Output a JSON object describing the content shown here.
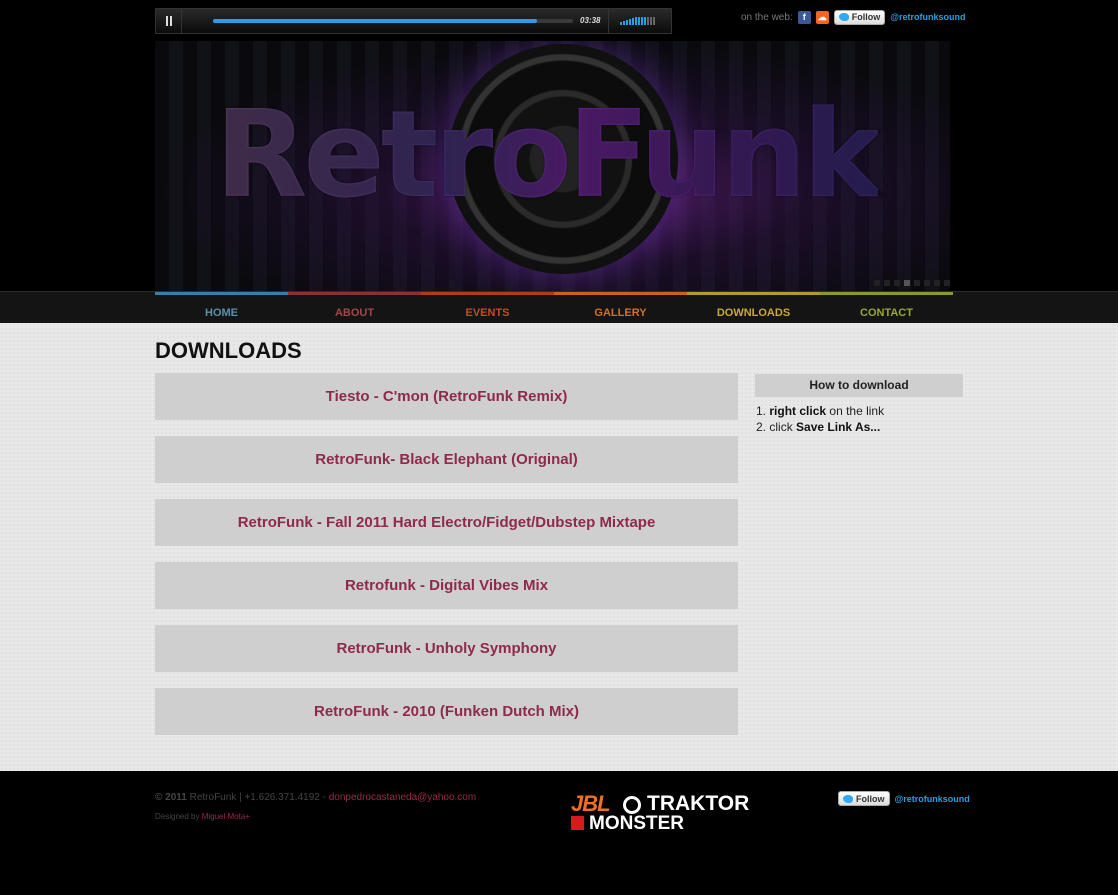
{
  "player": {
    "time": "03:38",
    "progress": 0.9
  },
  "social": {
    "label": "on the web:",
    "facebook_glyph": "f",
    "follow_label": "Follow",
    "handle": "@retrofunksound"
  },
  "banner": {
    "logo_text": "RetroFunk",
    "slides": 8,
    "active_slide": 4
  },
  "nav": {
    "items": [
      {
        "label": "HOME"
      },
      {
        "label": "ABOUT"
      },
      {
        "label": "EVENTS"
      },
      {
        "label": "GALLERY"
      },
      {
        "label": "DOWNLOADS"
      },
      {
        "label": "CONTACT"
      }
    ]
  },
  "main": {
    "title": "DOWNLOADS",
    "downloads": [
      {
        "label": "Tiesto - C'mon (RetroFunk Remix)"
      },
      {
        "label": "RetroFunk- Black Elephant (Original)"
      },
      {
        "label": "RetroFunk - Fall 2011 Hard Electro/Fidget/Dubstep Mixtape"
      },
      {
        "label": "Retrofunk - Digital Vibes Mix"
      },
      {
        "label": "RetroFunk - Unholy Symphony"
      },
      {
        "label": "RetroFunk - 2010 (Funken Dutch Mix)"
      }
    ]
  },
  "howto": {
    "title": "How to download",
    "step1_num": "1.",
    "step1_bold": "right click",
    "step1_rest": "on the link",
    "step2_num": "2.",
    "step2_pre": "click",
    "step2_bold": "Save Link As..."
  },
  "footer": {
    "copyright": "© 2011",
    "copy_rest": "RetroFunk | +1.626.371.4192 -",
    "email": "donpedrocastaneda@yahoo.com",
    "designed_by": "Designed by",
    "designer": "Miguel Mota+",
    "sponsor_jbl": "JBL",
    "sponsor_traktor": "TRAKTOR",
    "sponsor_monster": "MONSTER",
    "follow_label": "Follow",
    "handle": "@retrofunksound"
  },
  "colors": {
    "accent_blue": "#27a0e0",
    "download_text": "#8e2a4a",
    "nav_home": "#3a7ea8",
    "nav_about": "#8a3232",
    "nav_events": "#b03c1c",
    "nav_gallery": "#c8621c",
    "nav_downloads": "#b49a2a",
    "nav_contact": "#8a9a2a"
  }
}
